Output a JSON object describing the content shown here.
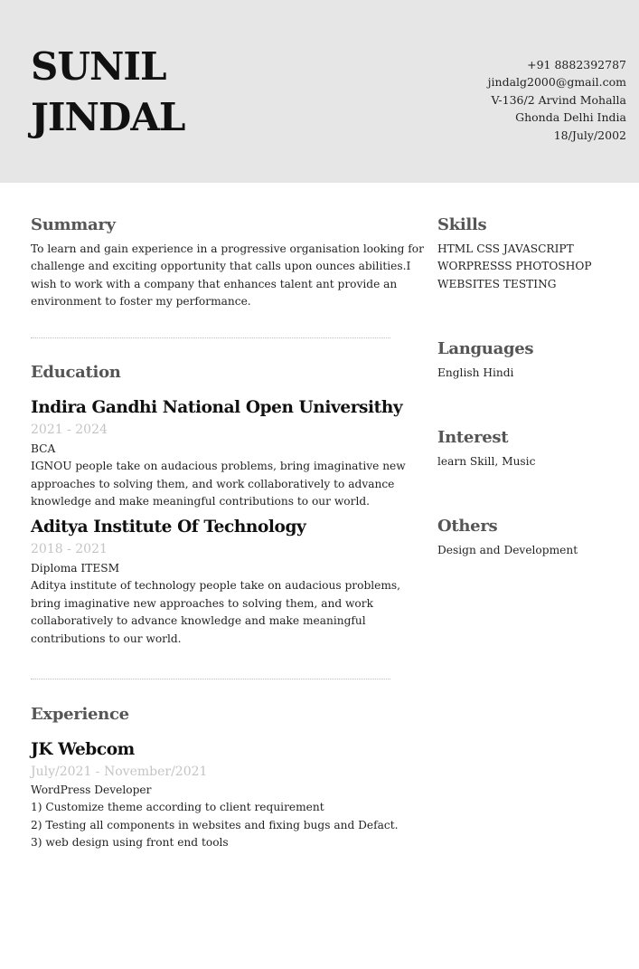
{
  "header": {
    "first_name": "SUNIL",
    "last_name": "JINDAL",
    "contact": {
      "phone": "+91 8882392787",
      "email": "jindalg2000@gmail.com",
      "address_line1": "V-136/2 Arvind Mohalla",
      "address_line2": "Ghonda Delhi India",
      "dob": "18/July/2002"
    }
  },
  "summary": {
    "title": "Summary",
    "lines": [
      "To learn and gain experience in a progressive organisation looking for",
      "challenge and exciting opportunity that calls upon ounces abilities.I",
      "wish to work with a company that enhances talent ant provide an",
      "environment to foster my performance."
    ]
  },
  "education": {
    "title": "Education",
    "entries": [
      {
        "institution": "Indira Gandhi National Open Universithy",
        "dates": "2021 - 2024",
        "degree": "BCA",
        "description": [
          "IGNOU people take on audacious problems, bring imaginative new",
          "approaches to solving them, and work collaboratively to advance",
          "knowledge and make meaningful contributions to our world."
        ]
      },
      {
        "institution": "Aditya Institute Of Technology",
        "dates": "2018 - 2021",
        "degree": "Diploma  ITESM",
        "description": [
          "Aditya institute of technology  people take on audacious problems,",
          "bring imaginative new approaches to solving them, and work",
          "collaboratively to advance knowledge and make meaningful",
          "contributions to our world."
        ]
      }
    ]
  },
  "experience": {
    "title": "Experience",
    "entries": [
      {
        "company": "JK Webcom",
        "dates": "July/2021 - November/2021",
        "role": "WordPress Developer",
        "points": [
          "1) Customize theme according to client requirement",
          "2) Testing all components in websites and fixing bugs and Defact.",
          "3) web design using front end tools"
        ]
      }
    ]
  },
  "skills": {
    "title": "Skills",
    "lines": [
      "HTML CSS JAVASCRIPT",
      "WORPRESSS PHOTOSHOP",
      "WEBSITES TESTING"
    ]
  },
  "languages": {
    "title": "Languages",
    "text": "English Hindi"
  },
  "interest": {
    "title": "Interest",
    "text": "learn Skill, Music"
  },
  "others": {
    "title": "Others",
    "text": "Design and Development"
  }
}
